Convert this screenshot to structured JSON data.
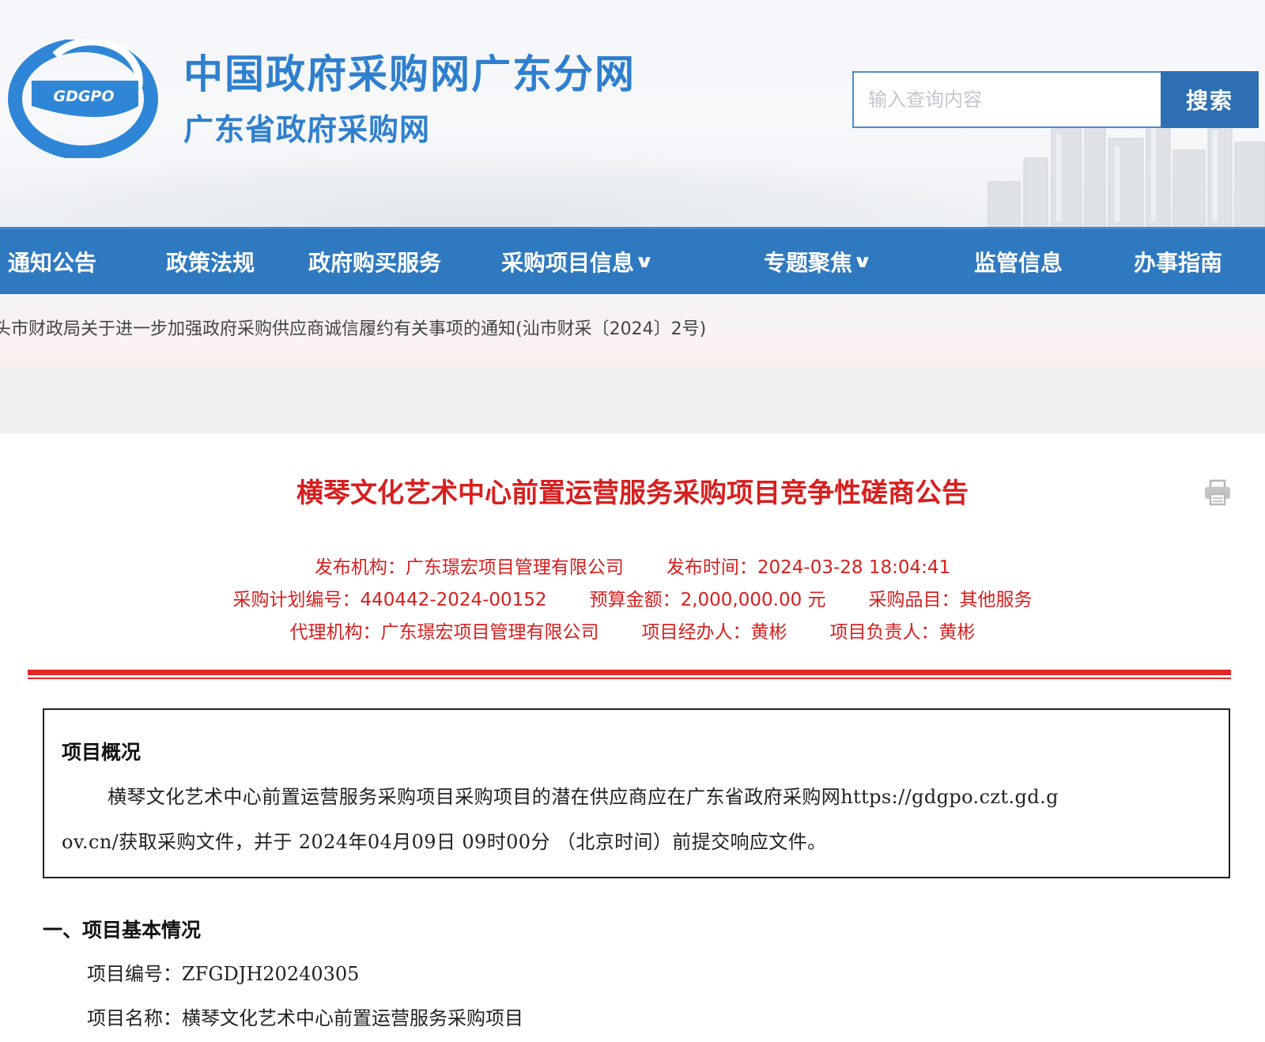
{
  "header": {
    "logo_text": "GDGPO",
    "site_title": "中国政府采购网广东分网",
    "site_subtitle": "广东省政府采购网",
    "search_placeholder": "输入查询内容",
    "search_button": "搜索"
  },
  "nav": {
    "items": [
      {
        "label": "通知公告",
        "dropdown": false
      },
      {
        "label": "政策法规",
        "dropdown": false
      },
      {
        "label": "政府购买服务",
        "dropdown": false
      },
      {
        "label": "采购项目信息",
        "dropdown": true
      },
      {
        "label": "专题聚焦",
        "dropdown": true
      },
      {
        "label": "监管信息",
        "dropdown": false
      },
      {
        "label": "办事指南",
        "dropdown": false
      }
    ],
    "dropdown_glyph": "∨"
  },
  "ticker": {
    "text": "头市财政局关于进一步加强政府采购供应商诚信履约有关事项的通知(汕市财采〔2024〕2号)"
  },
  "article": {
    "title": "横琴文化艺术中心前置运营服务采购项目竞争性磋商公告",
    "meta": {
      "publisher_label": "发布机构：",
      "publisher": "广东璟宏项目管理有限公司",
      "publish_time_label": "发布时间：",
      "publish_time": "2024-03-28 18:04:41",
      "plan_no_label": "采购计划编号：",
      "plan_no": "440442-2024-00152",
      "budget_label": "预算金额：",
      "budget": "2,000,000.00 元",
      "category_label": "采购品目：",
      "category": "其他服务",
      "agency_label": "代理机构：",
      "agency": "广东璟宏项目管理有限公司",
      "handler_label": "项目经办人：",
      "handler": "黄彬",
      "manager_label": "项目负责人：",
      "manager": "黄彬"
    },
    "overview": {
      "title": "项目概况",
      "line1": "横琴文化艺术中心前置运营服务采购项目采购项目的潜在供应商应在广东省政府采购网https://gdgpo.czt.gd.g",
      "line2": "ov.cn/获取采购文件，并于 2024年04月09日 09时00分 （北京时间）前提交响应文件。"
    },
    "section1": {
      "title": "一、项目基本情况",
      "project_no": "项目编号：ZFGDJH20240305",
      "project_name": "项目名称：横琴文化艺术中心前置运营服务采购项目"
    }
  },
  "colors": {
    "brand_blue": "#2f7fcf",
    "nav_blue": "#2f79c1",
    "accent_red": "#d81e1e"
  }
}
